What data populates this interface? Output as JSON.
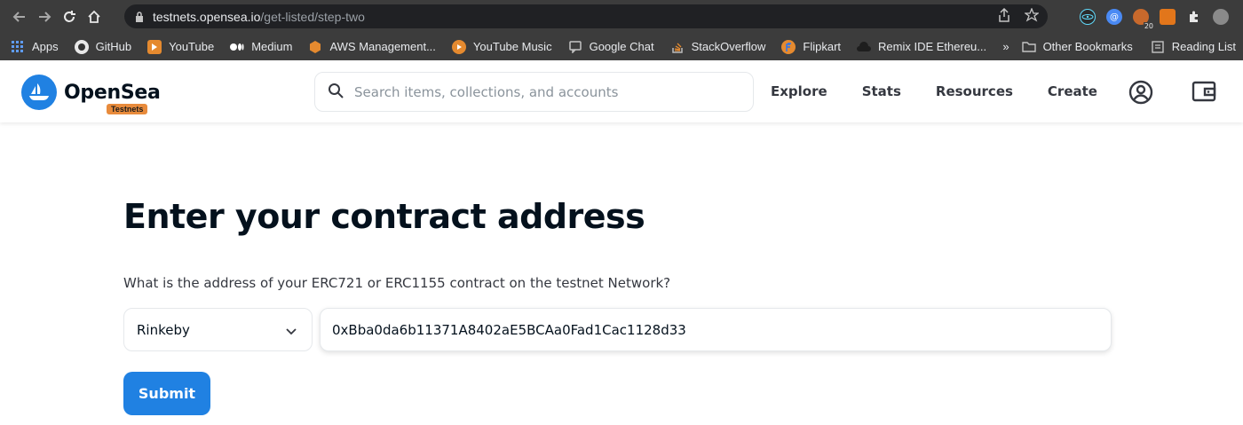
{
  "browser": {
    "url_host": "testnets.opensea.io",
    "url_path": "/get-listed/step-two",
    "extension_badge": "20",
    "bookmarks": [
      {
        "label": "Apps",
        "icon": "apps-grid-icon"
      },
      {
        "label": "GitHub",
        "icon": "github-icon"
      },
      {
        "label": "YouTube",
        "icon": "youtube-icon"
      },
      {
        "label": "Medium",
        "icon": "medium-icon"
      },
      {
        "label": "AWS Management...",
        "icon": "aws-icon"
      },
      {
        "label": "YouTube Music",
        "icon": "youtube-music-icon"
      },
      {
        "label": "Google Chat",
        "icon": "google-chat-icon"
      },
      {
        "label": "StackOverflow",
        "icon": "stackoverflow-icon"
      },
      {
        "label": "Flipkart",
        "icon": "flipkart-icon"
      },
      {
        "label": "Remix IDE Ethereu...",
        "icon": "remix-icon"
      }
    ],
    "overflow_label": "»",
    "other_bookmarks": "Other Bookmarks",
    "reading_list": "Reading List"
  },
  "header": {
    "logo_text": "OpenSea",
    "badge": "Testnets",
    "search_placeholder": "Search items, collections, and accounts",
    "nav": [
      "Explore",
      "Stats",
      "Resources",
      "Create"
    ]
  },
  "main": {
    "title": "Enter your contract address",
    "question": "What is the address of your ERC721 or ERC1155 contract on the testnet Network?",
    "network": "Rinkeby",
    "address": "0xBba0da6b11371A8402aE5BCAa0Fad1Cac1128d33",
    "submit_label": "Submit"
  },
  "colors": {
    "brand_blue": "#2081e2",
    "badge_orange": "#e88b3c",
    "chrome_bg": "#3c3c3c"
  }
}
